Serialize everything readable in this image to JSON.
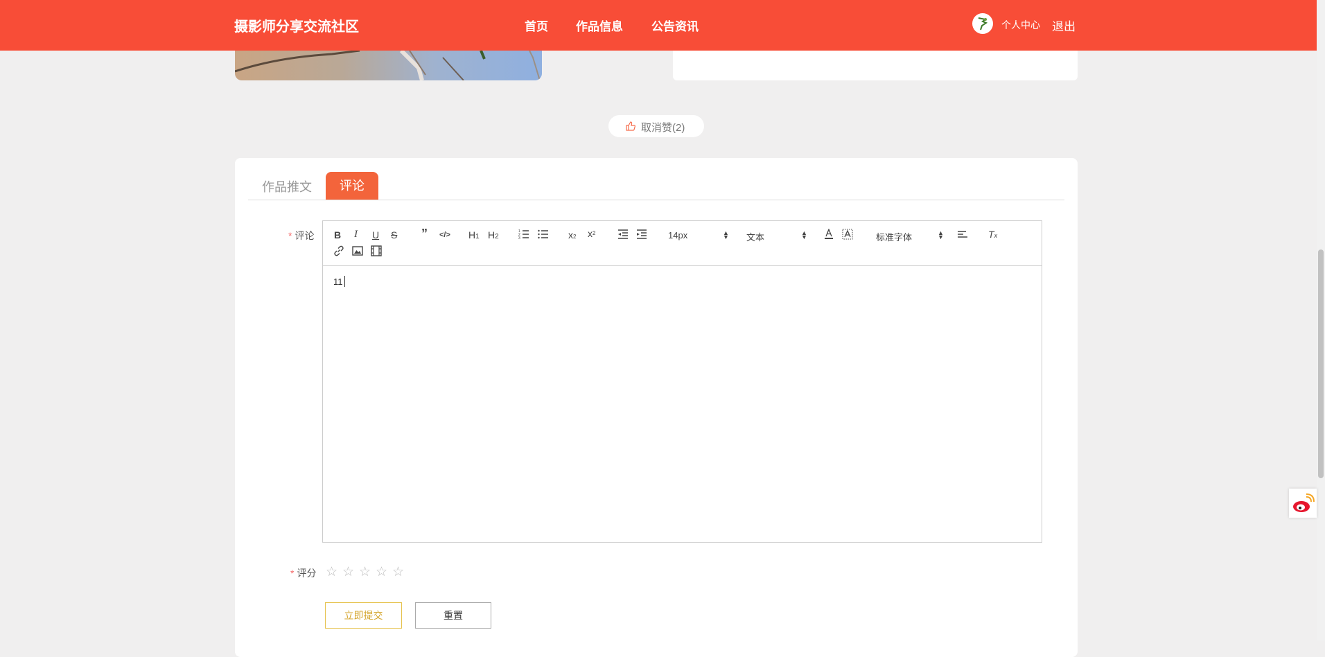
{
  "header": {
    "brand": "摄影师分享交流社区",
    "nav": [
      "首页",
      "作品信息",
      "公告资讯"
    ],
    "user_center": "个人中心",
    "logout": "退出"
  },
  "like": {
    "label": "取消赞(2)"
  },
  "tabs": [
    {
      "label": "作品推文",
      "active": false
    },
    {
      "label": "评论",
      "active": true
    }
  ],
  "form": {
    "comment_label": "评论",
    "required_mark": "*",
    "rating_label": "评分",
    "rating": {
      "value": 0,
      "max": 5
    },
    "submit": "立即提交",
    "reset": "重置"
  },
  "editor": {
    "font_size": "14px",
    "heading": "文本",
    "font_family": "标准字体",
    "content": "11"
  },
  "colors": {
    "header_bg": "#f84d37",
    "active_tab": "#f3643b",
    "submit_border": "#e6c34f",
    "required": "#f56c6c"
  },
  "icons": {
    "like": "thumb-up-icon",
    "weibo": "weibo-icon"
  }
}
